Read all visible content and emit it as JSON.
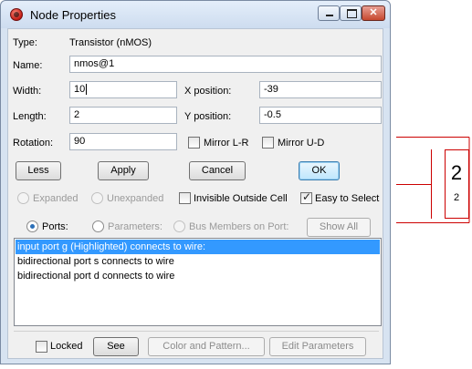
{
  "window": {
    "title": "Node Properties"
  },
  "fields": {
    "type_label": "Type:",
    "type_value": "Transistor (nMOS)",
    "name_label": "Name:",
    "name_value": "nmos@1",
    "width_label": "Width:",
    "width_value": "10",
    "xpos_label": "X position:",
    "xpos_value": "-39",
    "length_label": "Length:",
    "length_value": "2",
    "ypos_label": "Y position:",
    "ypos_value": "-0.5",
    "rotation_label": "Rotation:",
    "rotation_value": "90",
    "mirror_lr_label": "Mirror L-R",
    "mirror_ud_label": "Mirror U-D"
  },
  "buttons": {
    "less": "Less",
    "apply": "Apply",
    "cancel": "Cancel",
    "ok": "OK",
    "show_all": "Show All",
    "see": "See",
    "color_pattern": "Color and Pattern...",
    "edit_parameters": "Edit Parameters"
  },
  "options": {
    "expanded": "Expanded",
    "unexpanded": "Unexpanded",
    "invisible_outside_cell": "Invisible Outside Cell",
    "easy_to_select": "Easy to Select",
    "easy_to_select_checked": true,
    "ports": "Ports:",
    "parameters": "Parameters:",
    "bus_members": "Bus Members on Port:",
    "locked": "Locked"
  },
  "port_list": [
    "input port g (Highlighted) connects to wire:",
    "bidirectional port s connects to wire",
    "bidirectional port d connects to wire"
  ],
  "canvas": {
    "label_large": "2",
    "label_small": "2"
  },
  "colors": {
    "selection": "#3399ff",
    "node_stroke": "#cc0000"
  }
}
